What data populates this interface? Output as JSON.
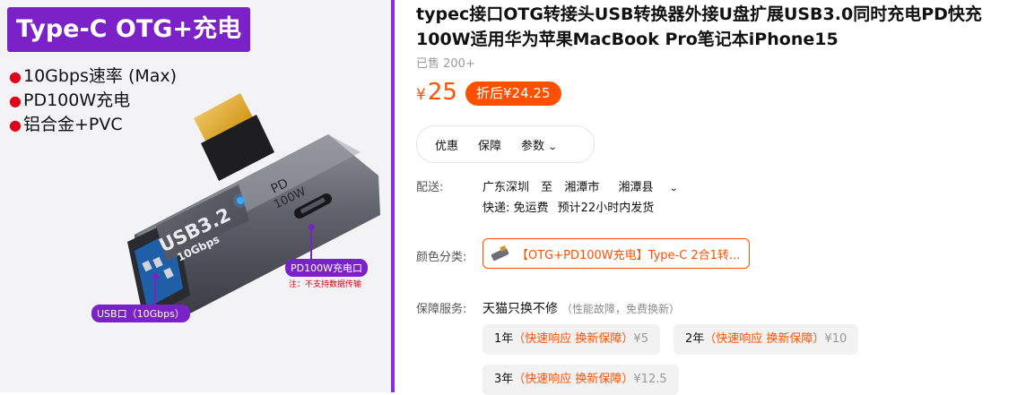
{
  "image": {
    "title": "Type-C OTG+充电",
    "features": [
      "10Gbps速率 (Max)",
      "PD100W充电",
      "铝合金+PVC"
    ],
    "device_text": {
      "usb": "USB3.2",
      "speed": "10Gbps",
      "pd": "PD",
      "watt": "100W"
    },
    "callout_pd": "PD100W充电口",
    "callout_pd_note": "注：不支持数据传输",
    "callout_usb": "USB口（10Gbps）",
    "accent_color": "#7a22c8"
  },
  "product": {
    "title": "typec接口OTG转接头USB转换器外接U盘扩展USB3.0同时充电PD快充100W适用华为苹果MacBook Pro笔记本iPhone15",
    "sold": "已售 200+",
    "price_symbol": "¥",
    "price": "25",
    "discount_label": "折后¥24.25",
    "brand_color": "#ff5000"
  },
  "tabs": [
    {
      "label": "优惠"
    },
    {
      "label": "保障"
    },
    {
      "label": "参数",
      "icon": "chevron-down-icon"
    }
  ],
  "shipping": {
    "label": "配送:",
    "from": "广东深圳",
    "to_word": "至",
    "city": "湘潭市",
    "county": "湘潭县",
    "express": "快递: 免运费",
    "estimate": "预计22小时内发货"
  },
  "color": {
    "label": "颜色分类:",
    "option": "【OTG+PD100W充电】Type-C 2合1转..."
  },
  "service": {
    "label": "保障服务:",
    "title": "天猫只换不修",
    "subtitle": "（性能故障，免费换新）",
    "options": [
      {
        "year": "1年",
        "promo": "（快速响应 换新保障）",
        "price": "¥5"
      },
      {
        "year": "2年",
        "promo": "（快速响应 换新保障）",
        "price": "¥10"
      },
      {
        "year": "3年",
        "promo": "（快速响应 换新保障）",
        "price": "¥12.5"
      }
    ]
  }
}
